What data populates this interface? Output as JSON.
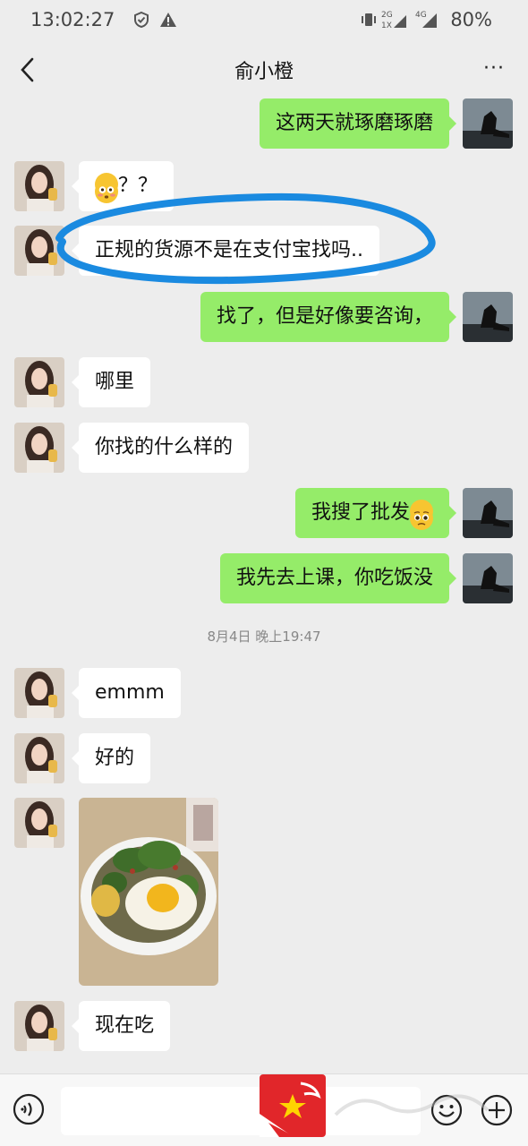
{
  "status_bar": {
    "time": "13:02:27",
    "battery": "80%",
    "icons": [
      "shield-icon",
      "alert-icon",
      "vibrate-icon",
      "signal-2g-icon",
      "signal-4g-icon"
    ]
  },
  "header": {
    "title": "俞小橙",
    "more_label": "···"
  },
  "messages": [
    {
      "side": "right",
      "text": "这两天就琢磨琢磨"
    },
    {
      "side": "left",
      "text": "？？",
      "emoji": "flushed-face"
    },
    {
      "side": "left",
      "text": "正规的货源不是在支付宝找吗..",
      "annotation": "blue-ellipse"
    },
    {
      "side": "right",
      "text": "找了，但是好像要咨询，"
    },
    {
      "side": "left",
      "text": "哪里"
    },
    {
      "side": "left",
      "text": "你找的什么样的"
    },
    {
      "side": "right",
      "text": "我搜了批发",
      "emoji": "pleading-face"
    },
    {
      "side": "right",
      "text": "我先去上课，你吃饭没"
    },
    {
      "side": "left",
      "text": "emmm"
    },
    {
      "side": "left",
      "text": "好的"
    },
    {
      "side": "left",
      "image": "food-bowl-photo"
    },
    {
      "side": "left",
      "text": "现在吃"
    }
  ],
  "timestamp": "8月4日 晚上19:47",
  "input_bar": {
    "placeholder": ""
  },
  "colors": {
    "sent_bubble": "#95ec69",
    "received_bubble": "#ffffff",
    "background": "#ededed",
    "annotation": "#1a8ae0"
  }
}
